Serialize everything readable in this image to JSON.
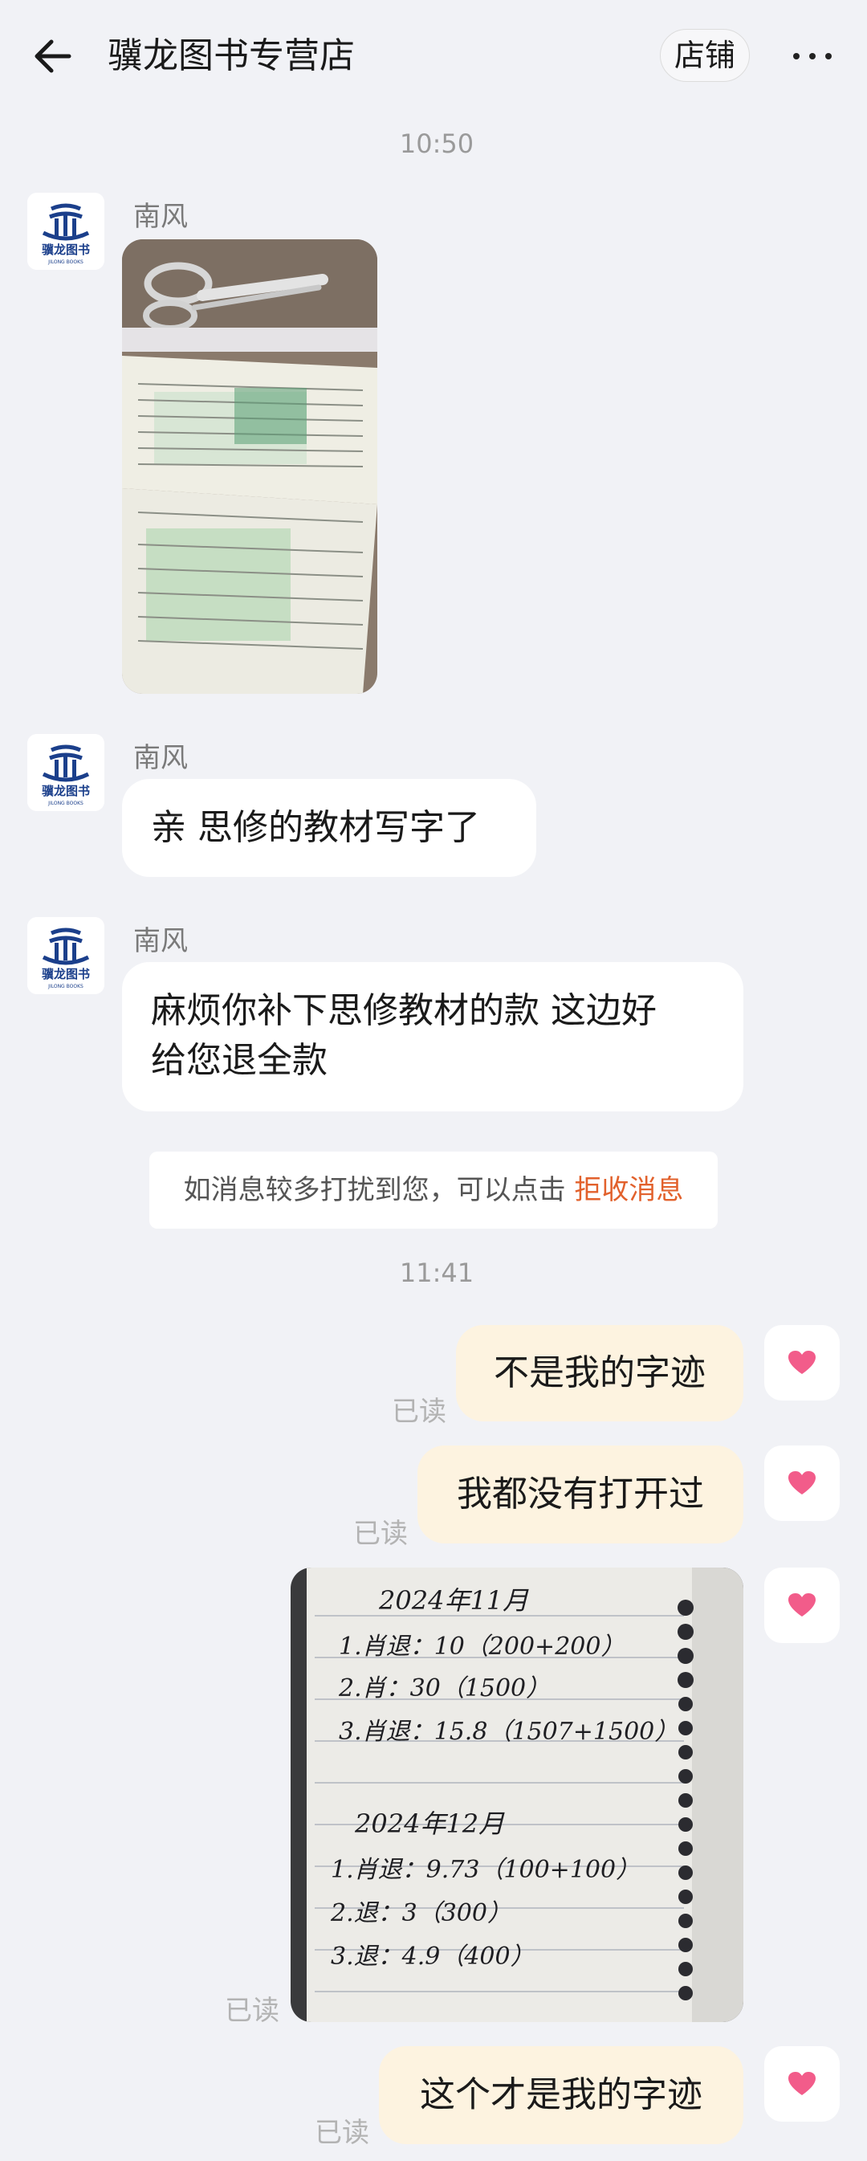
{
  "header": {
    "title": "骥龙图书专营店",
    "shop_button": "店铺"
  },
  "avatar": {
    "brand_text": "骥龙图书",
    "brand_sub": "JILONG BOOKS",
    "brand_color": "#1b3f8b"
  },
  "messages": {
    "time1": "10:50",
    "msg1": {
      "sender": "南风"
    },
    "msg2": {
      "sender": "南风",
      "text": "亲 思修的教材写字了"
    },
    "msg3": {
      "sender": "南风",
      "line1": "麻烦你补下思修教材的款 这边好",
      "line2": "给您退全款"
    },
    "notice": {
      "text": "如消息较多打扰到您，可以点击 ",
      "link": "拒收消息"
    },
    "time2": "11:41",
    "r1": {
      "text": "不是我的字迹",
      "status": "已读"
    },
    "r2": {
      "text": "我都没有打开过",
      "status": "已读"
    },
    "r3": {
      "status": "已读",
      "notebook_lines": [
        "2024年11月",
        "1.肖退：10（200+200）",
        "2.肖：30（1500）",
        "3.肖退：15.8（1507+1500）",
        "2024年12月",
        "1.肖退：9.73（100+100）",
        "2.退：3（300）",
        "3.退：4.9（400）"
      ]
    },
    "r4": {
      "text": "这个才是我的字迹",
      "status": "已读"
    }
  },
  "colors": {
    "background": "#f1f2f6",
    "outgoing_bubble": "#fdf3e0",
    "heart": "#f25c8a",
    "link": "#e2612c"
  }
}
